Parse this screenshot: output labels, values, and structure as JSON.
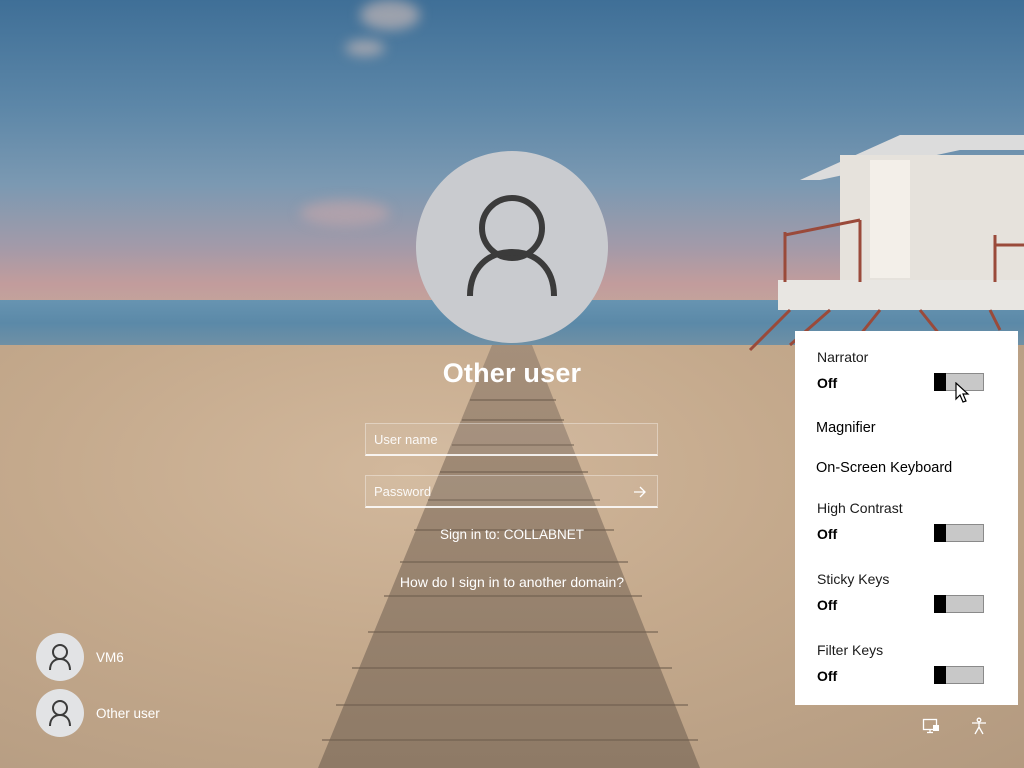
{
  "login": {
    "title": "Other user",
    "username_placeholder": "User name",
    "username_value": "",
    "password_placeholder": "Password",
    "password_value": "",
    "sign_in_to": "Sign in to: COLLABNET",
    "domain_help_link": "How do I sign in to another domain?"
  },
  "users": [
    {
      "name": "VM6"
    },
    {
      "name": "Other user"
    }
  ],
  "ease_of_access": {
    "narrator": {
      "label": "Narrator",
      "state": "Off"
    },
    "magnifier": {
      "label": "Magnifier"
    },
    "onscreen_keyboard": {
      "label": "On-Screen Keyboard"
    },
    "high_contrast": {
      "label": "High Contrast",
      "state": "Off"
    },
    "sticky_keys": {
      "label": "Sticky Keys",
      "state": "Off"
    },
    "filter_keys": {
      "label": "Filter Keys",
      "state": "Off"
    }
  },
  "tray": {
    "icons": [
      "network-icon",
      "ease-of-access-icon"
    ]
  },
  "colors": {
    "panel_bg": "#ffffff",
    "toggle_off_track": "#c8c8c8",
    "avatar_bg": "#c9cbcf"
  }
}
